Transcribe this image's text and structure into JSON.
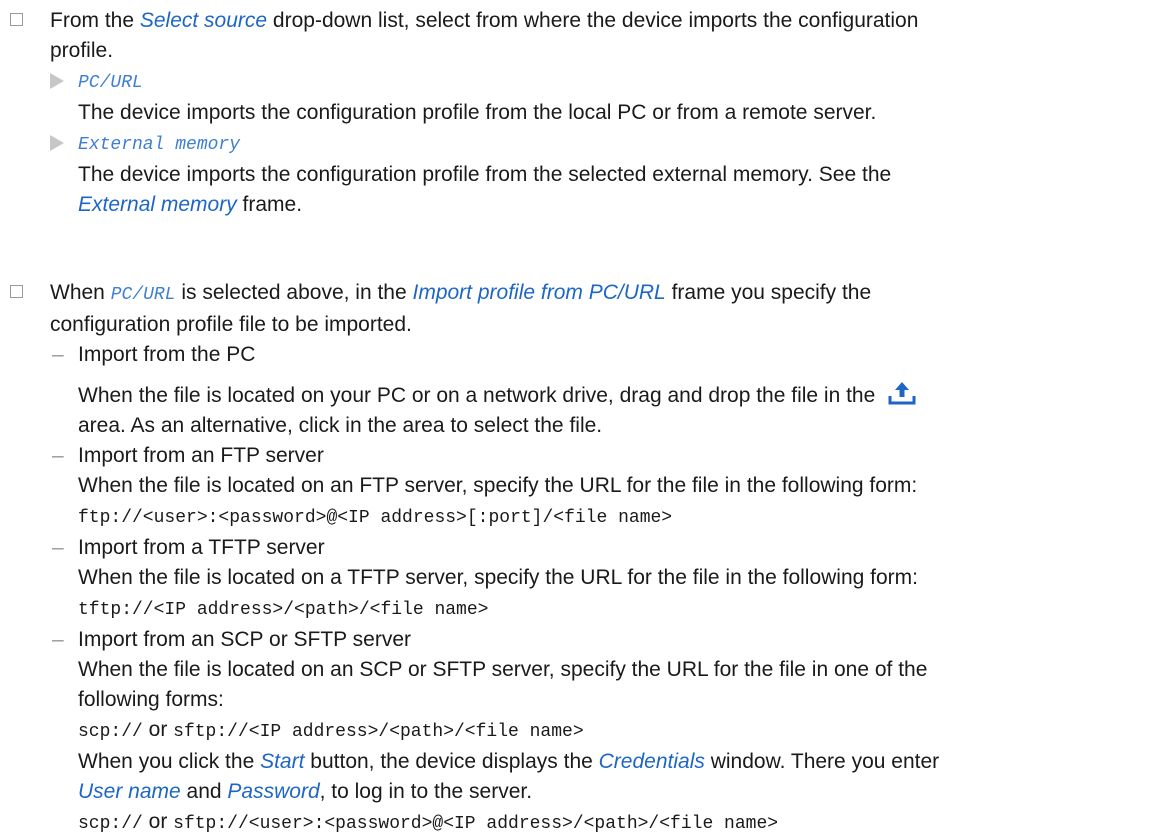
{
  "step1": {
    "pre": "From the ",
    "link": "Select source",
    "post": " drop-down list, select from where the device imports the configuration",
    "line2": "profile.",
    "options": [
      {
        "name": "PC/URL",
        "desc": "The device imports the configuration profile from the local PC or from a remote server."
      },
      {
        "name": "External memory",
        "desc1": "The device imports the configuration profile from the selected external memory. See the",
        "link": "External memory",
        "post": " frame."
      }
    ]
  },
  "step2": {
    "pre": "When ",
    "code": "PC/URL",
    "mid": " is selected above, in the ",
    "link": "Import profile from PC/URL",
    "post": " frame you specify the",
    "line2": "configuration profile file to be imported.",
    "pc": {
      "title": "Import from the PC",
      "text1": "When the file is located on your PC or on a network drive, drag and drop the file in the",
      "icon": "upload-icon",
      "text2": "area. As an alternative, click in the area to select the file."
    },
    "ftp": {
      "title": "Import from an FTP server",
      "text": "When the file is located on an FTP server, specify the URL for the file in the following form:",
      "code": "ftp://<user>:<password>@<IP address>[:port]/<file name>"
    },
    "tftp": {
      "title": "Import from a TFTP server",
      "text": "When the file is located on a TFTP server, specify the URL for the file in the following form:",
      "code": "tftp://<IP address>/<path>/<file name>"
    },
    "scp": {
      "title": "Import from an SCP or SFTP server",
      "text1": "When the file is located on an SCP or SFTP server, specify the URL for the file in one of the",
      "text2": "following forms:",
      "code1a": "scp://",
      "or": " or ",
      "code1b": "sftp://<IP address>/<path>/<file name>",
      "s_pre": "When you click the ",
      "s_start": "Start",
      "s_mid": " button, the device displays the ",
      "s_cred": "Credentials",
      "s_post": " window. There you enter",
      "u_user": "User name",
      "u_and": " and ",
      "u_pass": "Password",
      "u_post": ", to log in to the server.",
      "code2a": "scp://",
      "code2b": "sftp://<user>:<password>@<IP address>/<path>/<file name>"
    }
  },
  "colors": {
    "link": "#1d66c6",
    "checkbox": "#9a9a9a",
    "bullet": "#c7c7c7",
    "icon": "#1d66c6"
  }
}
